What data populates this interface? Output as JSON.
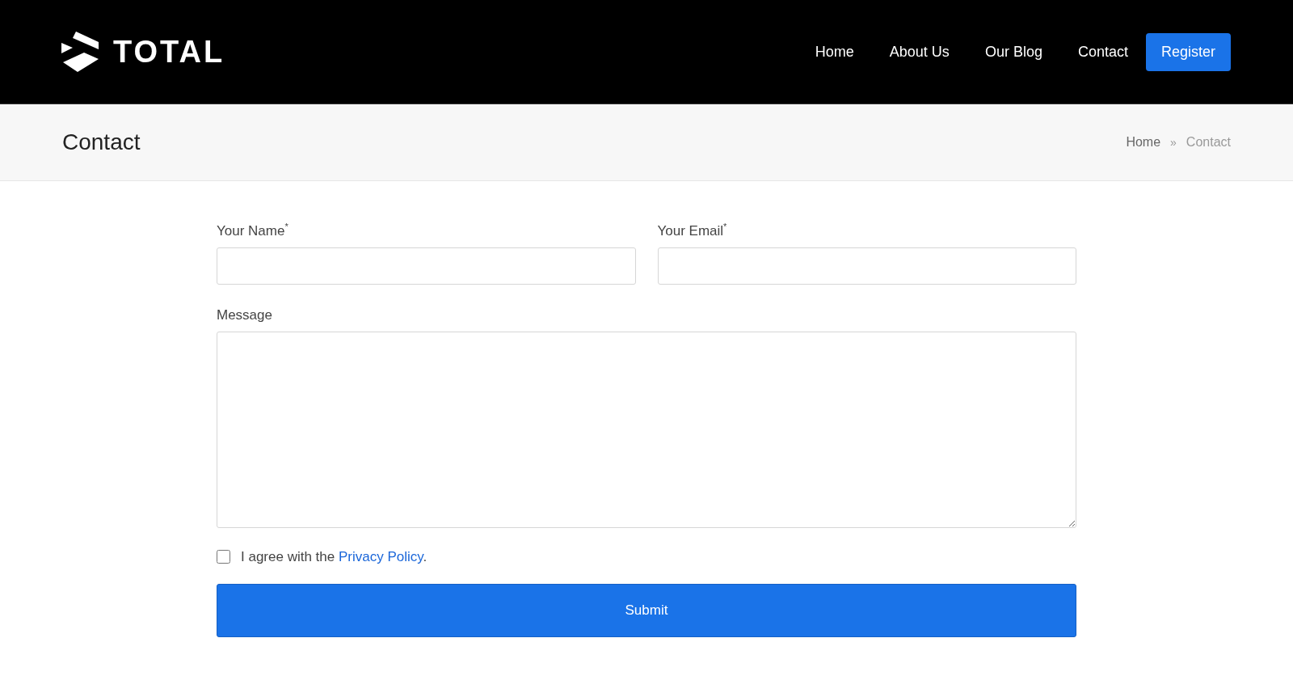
{
  "header": {
    "logo": "TOTAL",
    "nav": [
      "Home",
      "About Us",
      "Our Blog",
      "Contact"
    ],
    "cta": "Register"
  },
  "page_title": {
    "title": "Contact",
    "breadcrumb": [
      {
        "label": "Home",
        "kind": "link"
      },
      {
        "label": "Contact",
        "kind": "current"
      }
    ],
    "separator": "»"
  },
  "form": {
    "fields": [
      {
        "label": "Your Name$^{*}$",
        "kind": "input"
      },
      {
        "label": "Your Email$^{*}$",
        "kind": "input"
      },
      {
        "label": "Message",
        "kind": "textarea"
      }
    ],
    "consent": {
      "checked": false,
      "text": "I agree with the",
      "link": "Privacy Policy",
      "after": "."
    },
    "submit": "Submit"
  }
}
